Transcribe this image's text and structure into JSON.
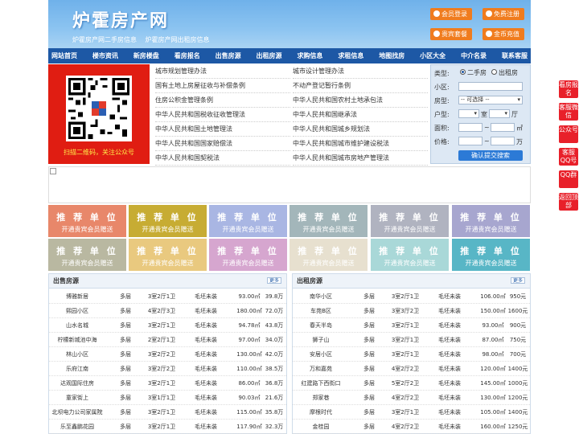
{
  "header": {
    "logo": "炉霍房产网",
    "sub_links": [
      "炉霍房产网二手房信息",
      "炉霍房产网出租房信息"
    ],
    "buttons": [
      "会员登录",
      "免费注册",
      "贵宾套餐",
      "金币充值"
    ]
  },
  "nav": [
    "网站首页",
    "楼市资讯",
    "新房楼盘",
    "看房报名",
    "出售房源",
    "出租房源",
    "求购信息",
    "求租信息",
    "地图找房",
    "小区大全",
    "中介名录",
    "联系客服"
  ],
  "qr_caption": "扫描二维码，关注公众号",
  "links_left": [
    "城市规划管理办法",
    "国有土地上房屋征收与补偿条例",
    "住房公积金管理条例",
    "中华人民共和国税收征收管理法",
    "中华人民共和国土地管理法",
    "中华人民共和国国家赔偿法",
    "中华人民共和国契税法"
  ],
  "links_right": [
    "城市设计管理办法",
    "不动产登记暂行条例",
    "中华人民共和国农村土地承包法",
    "中华人民共和国继承法",
    "中华人民共和国城乡规划法",
    "中华人民共和国城市维护建设税法",
    "中华人民共和国城市房地产管理法"
  ],
  "search": {
    "type_label": "类型:",
    "type_options": [
      "二手房",
      "出租房"
    ],
    "type_selected": "二手房",
    "community_label": "小区:",
    "house_label": "房型:",
    "house_select": "-- 可选择 --",
    "layout_label": "户型:",
    "room_unit": "室",
    "hall_unit": "厅",
    "area_label": "面积:",
    "area_unit": "㎡",
    "price_label": "价格:",
    "price_unit": "万",
    "range_sep": "~",
    "submit": "确认提交搜索"
  },
  "ads": {
    "title": "推 荐 单 位",
    "subtitle": "开通贵宾会员赠送",
    "colors": [
      "#e8876a",
      "#c7ac33",
      "#a9b6e3",
      "#a3b6ba",
      "#b0b3c0",
      "#a7a6cf",
      "#b9b8a1",
      "#e9c97f",
      "#d6a6cf",
      "#e7e0cf",
      "#a9d8d8",
      "#58b6c6"
    ]
  },
  "sale": {
    "title": "出售房源",
    "more": "更多",
    "rows": [
      [
        "博雅新居",
        "多层",
        "3室2厅1卫",
        "毛坯未装",
        "93.00㎡",
        "39.8万"
      ],
      [
        "熙园小区",
        "多层",
        "4室2厅3卫",
        "毛坯未装",
        "180.00㎡",
        "72.0万"
      ],
      [
        "山水名城",
        "多层",
        "3室2厅1卫",
        "毛坯未装",
        "94.78㎡",
        "43.8万"
      ],
      [
        "柠檬新城池中海",
        "多层",
        "2室2厅1卫",
        "毛坯未装",
        "97.00㎡",
        "34.0万"
      ],
      [
        "林山小区",
        "多层",
        "3室2厅2卫",
        "毛坯未装",
        "130.00㎡",
        "42.0万"
      ],
      [
        "乐府江南",
        "多层",
        "3室2厅2卫",
        "毛坯未装",
        "110.00㎡",
        "38.5万"
      ],
      [
        "达观国际住房",
        "多层",
        "3室2厅1卫",
        "毛坯未装",
        "86.00㎡",
        "36.8万"
      ],
      [
        "童家街上",
        "多层",
        "3室1厅1卫",
        "毛坯未装",
        "90.03㎡",
        "21.6万"
      ],
      [
        "北坝电力公司家属院",
        "多层",
        "3室2厅1卫",
        "毛坯未装",
        "115.00㎡",
        "35.8万"
      ],
      [
        "乐至鑫鹏花园",
        "多层",
        "3室2厅1卫",
        "毛坯未装",
        "117.90㎡",
        "32.3万"
      ]
    ]
  },
  "rent": {
    "title": "出租房源",
    "more": "更多",
    "rows": [
      [
        "南华小区",
        "多层",
        "3室2厅1卫",
        "毛坯未装",
        "106.00㎡",
        "950元"
      ],
      [
        "车苑B区",
        "多层",
        "3室3厅2卫",
        "毛坯未装",
        "150.00㎡",
        "1600元"
      ],
      [
        "春天半岛",
        "多层",
        "3室2厅1卫",
        "毛坯未装",
        "93.00㎡",
        "900元"
      ],
      [
        "狮子山",
        "多层",
        "3室2厅1卫",
        "毛坯未装",
        "87.00㎡",
        "750元"
      ],
      [
        "安居小区",
        "多层",
        "3室2厅1卫",
        "毛坯未装",
        "98.00㎡",
        "700元"
      ],
      [
        "万和嘉苑",
        "多层",
        "4室2厅2卫",
        "毛坯未装",
        "120.00㎡",
        "1400元"
      ],
      [
        "红建路下西街口",
        "多层",
        "5室2厅2卫",
        "毛坯未装",
        "145.00㎡",
        "1000元"
      ],
      [
        "郑家巷",
        "多层",
        "4室2厅2卫",
        "毛坯未装",
        "130.00㎡",
        "1200元"
      ],
      [
        "摩根时代",
        "多层",
        "3室2厅1卫",
        "毛坯未装",
        "105.00㎡",
        "1400元"
      ],
      [
        "金桂园",
        "多层",
        "4室2厅2卫",
        "毛坯未装",
        "160.00㎡",
        "1250元"
      ]
    ]
  },
  "side_buttons": [
    "看房报名",
    "客服微信",
    "公众号",
    "客服QQ号",
    "QQ群",
    "返回顶部"
  ]
}
